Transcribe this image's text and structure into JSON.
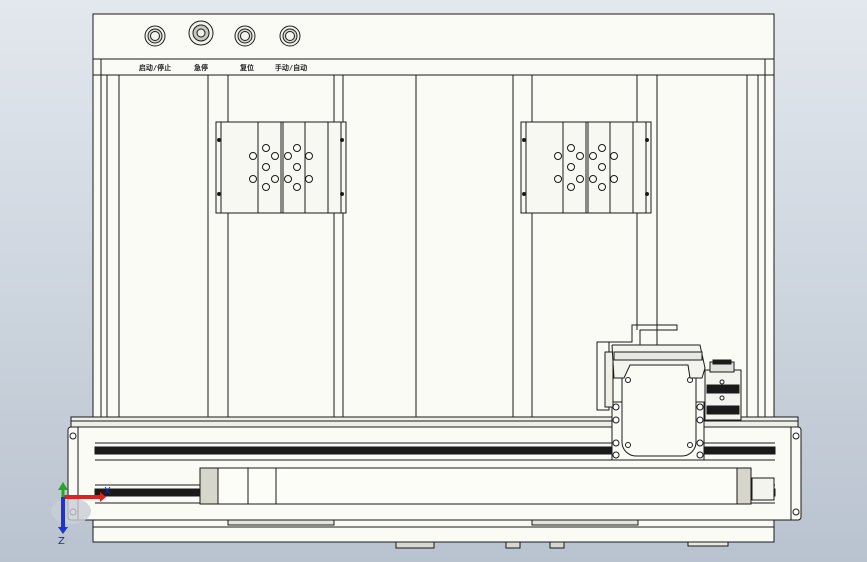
{
  "control_panel": {
    "buttons": [
      {
        "label": "启动/停止",
        "icon": "push-button-icon"
      },
      {
        "label": "急停",
        "icon": "emergency-stop-icon"
      },
      {
        "label": "复位",
        "icon": "push-button-icon"
      },
      {
        "label": "手动/自动",
        "icon": "push-button-icon"
      }
    ]
  },
  "triad": {
    "axes": [
      {
        "label": "X",
        "color": "#dd2222"
      },
      {
        "label": "Y",
        "color": "#22aa22"
      },
      {
        "label": "Z",
        "color": "#2233cc"
      }
    ]
  },
  "colors": {
    "background_top": "#e3e8ee",
    "background_bottom": "#b9c3cf",
    "frame_fill": "#fbfbf6",
    "line": "#1a1a1a"
  }
}
